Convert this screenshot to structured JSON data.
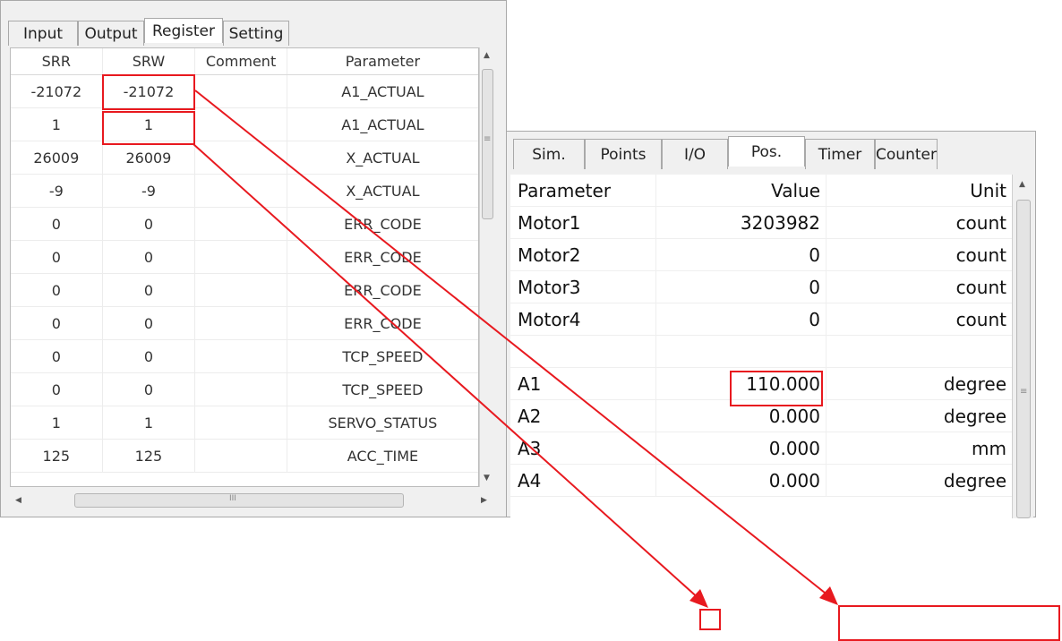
{
  "register_panel": {
    "tabs": [
      {
        "label": "Input",
        "active": false
      },
      {
        "label": "Output",
        "active": false
      },
      {
        "label": "Register",
        "active": true
      },
      {
        "label": "Setting",
        "active": false
      }
    ],
    "columns": [
      "SRR",
      "SRW",
      "Comment",
      "Parameter"
    ],
    "rows": [
      {
        "srr": "-21072",
        "srw": "-21072",
        "comment": "",
        "parameter": "A1_ACTUAL"
      },
      {
        "srr": "1",
        "srw": "1",
        "comment": "",
        "parameter": "A1_ACTUAL"
      },
      {
        "srr": "26009",
        "srw": "26009",
        "comment": "",
        "parameter": "X_ACTUAL"
      },
      {
        "srr": "-9",
        "srw": "-9",
        "comment": "",
        "parameter": "X_ACTUAL"
      },
      {
        "srr": "0",
        "srw": "0",
        "comment": "",
        "parameter": "ERR_CODE"
      },
      {
        "srr": "0",
        "srw": "0",
        "comment": "",
        "parameter": "ERR_CODE"
      },
      {
        "srr": "0",
        "srw": "0",
        "comment": "",
        "parameter": "ERR_CODE"
      },
      {
        "srr": "0",
        "srw": "0",
        "comment": "",
        "parameter": "ERR_CODE"
      },
      {
        "srr": "0",
        "srw": "0",
        "comment": "",
        "parameter": "TCP_SPEED"
      },
      {
        "srr": "0",
        "srw": "0",
        "comment": "",
        "parameter": "TCP_SPEED"
      },
      {
        "srr": "1",
        "srw": "1",
        "comment": "",
        "parameter": "SERVO_STATUS"
      },
      {
        "srr": "125",
        "srw": "125",
        "comment": "",
        "parameter": "ACC_TIME"
      }
    ],
    "scroll": {
      "up": "▲",
      "down": "▼",
      "left": "◀",
      "right": "▶",
      "grip": "≡",
      "hgrip": "III"
    }
  },
  "position_panel": {
    "tabs": [
      {
        "label": "Sim.",
        "active": false
      },
      {
        "label": "Points",
        "active": false
      },
      {
        "label": "I/O",
        "active": false
      },
      {
        "label": "Pos.",
        "active": true
      },
      {
        "label": "Timer",
        "active": false
      },
      {
        "label": "Counter",
        "active": false
      }
    ],
    "columns": [
      "Parameter",
      "Value",
      "Unit"
    ],
    "rows": [
      {
        "parameter": "Motor1",
        "value": "3203982",
        "unit": "count"
      },
      {
        "parameter": "Motor2",
        "value": "0",
        "unit": "count"
      },
      {
        "parameter": "Motor3",
        "value": "0",
        "unit": "count"
      },
      {
        "parameter": "Motor4",
        "value": "0",
        "unit": "count"
      },
      {
        "parameter": "",
        "value": "",
        "unit": ""
      },
      {
        "parameter": "A1",
        "value": "110.000",
        "unit": "degree"
      },
      {
        "parameter": "A2",
        "value": "0.000",
        "unit": "degree"
      },
      {
        "parameter": "A3",
        "value": "0.000",
        "unit": "mm"
      },
      {
        "parameter": "A4",
        "value": "0.000",
        "unit": "degree"
      }
    ],
    "scroll": {
      "up": "▲",
      "grip": "≡"
    }
  },
  "colors": {
    "annotation": "#e8191f",
    "panel_bg": "#f0f0f0",
    "border": "#a9a9a9"
  }
}
